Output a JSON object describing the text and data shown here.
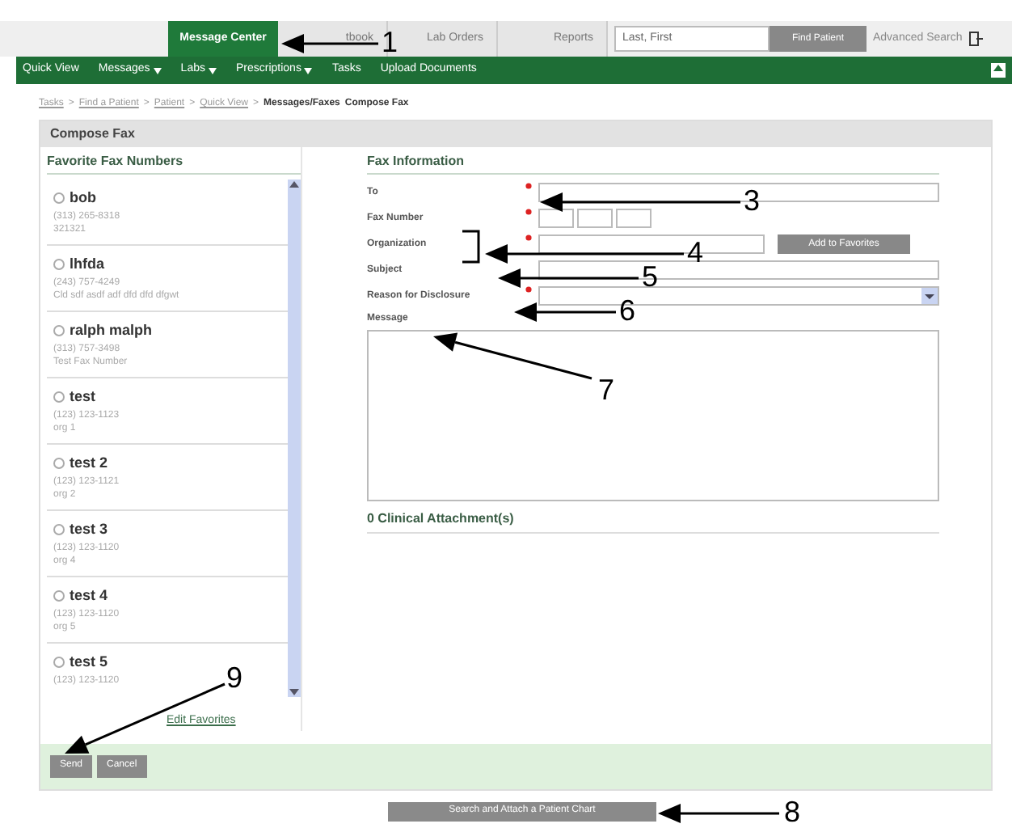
{
  "top_tabs": [
    {
      "label": "Message Center",
      "selected": true
    },
    {
      "label": "tbook",
      "selected": false
    },
    {
      "label": "Lab Orders",
      "selected": false
    },
    {
      "label": "Reports",
      "selected": false
    }
  ],
  "patient_search": {
    "placeholder": "Last, First",
    "button": "Find Patient",
    "advanced_link": "Advanced Search"
  },
  "nav": [
    {
      "label": "Quick View",
      "has_menu": false
    },
    {
      "label": "Messages",
      "has_menu": true
    },
    {
      "label": "Labs",
      "has_menu": true
    },
    {
      "label": "Prescriptions",
      "has_menu": true
    },
    {
      "label": "Tasks",
      "has_menu": false
    },
    {
      "label": "Upload Documents",
      "has_menu": false
    }
  ],
  "breadcrumb": {
    "separator": ">",
    "links": [
      "Tasks",
      "Find a Patient",
      "Patient",
      "Quick View"
    ],
    "current": "Messages/Faxes",
    "page": "Compose Fax"
  },
  "panel_title": "Compose Fax",
  "favorites": {
    "title": "Favorite Fax Numbers",
    "items": [
      {
        "name": "bob",
        "phone": "(313) 265-8318",
        "note": "321321",
        "selected": false
      },
      {
        "name": "lhfda",
        "phone": "(243) 757-4249",
        "note": "Cld sdf asdf adf dfd dfd dfgwt",
        "selected": false
      },
      {
        "name": "ralph malph",
        "phone": "(313) 757-3498",
        "note": "Test Fax Number",
        "selected": false
      },
      {
        "name": "test",
        "phone": "(123) 123-1123",
        "note": "org 1",
        "selected": false
      },
      {
        "name": "test 2",
        "phone": "(123) 123-1121",
        "note": "org 2",
        "selected": false
      },
      {
        "name": "test 3",
        "phone": "(123) 123-1120",
        "note": "org 4",
        "selected": false
      },
      {
        "name": "test 4",
        "phone": "(123) 123-1120",
        "note": "org 5",
        "selected": false
      },
      {
        "name": "test 5",
        "phone": "(123) 123-1120",
        "selected": false
      }
    ],
    "edit_link": "Edit Favorites"
  },
  "fax_info": {
    "title": "Fax Information",
    "fields": [
      {
        "label": "To",
        "kind": "text",
        "required": true
      },
      {
        "label": "Fax Number",
        "kind": "phone",
        "required": true
      },
      {
        "label": "Organization",
        "kind": "org",
        "required": true,
        "button": "Add to Favorites"
      },
      {
        "label": "Subject",
        "kind": "text",
        "required": false
      },
      {
        "label": "Reason for Disclosure",
        "kind": "select",
        "required": true
      },
      {
        "label": "Message",
        "kind": "textarea",
        "required": false
      }
    ],
    "attachments": "0 Clinical Attachment(s)"
  },
  "actions": [
    "Send",
    "Cancel"
  ],
  "attach_button": "Search and Attach a Patient Chart",
  "callouts": [
    "1",
    "3",
    "4",
    "5",
    "6",
    "7",
    "8",
    "9"
  ]
}
